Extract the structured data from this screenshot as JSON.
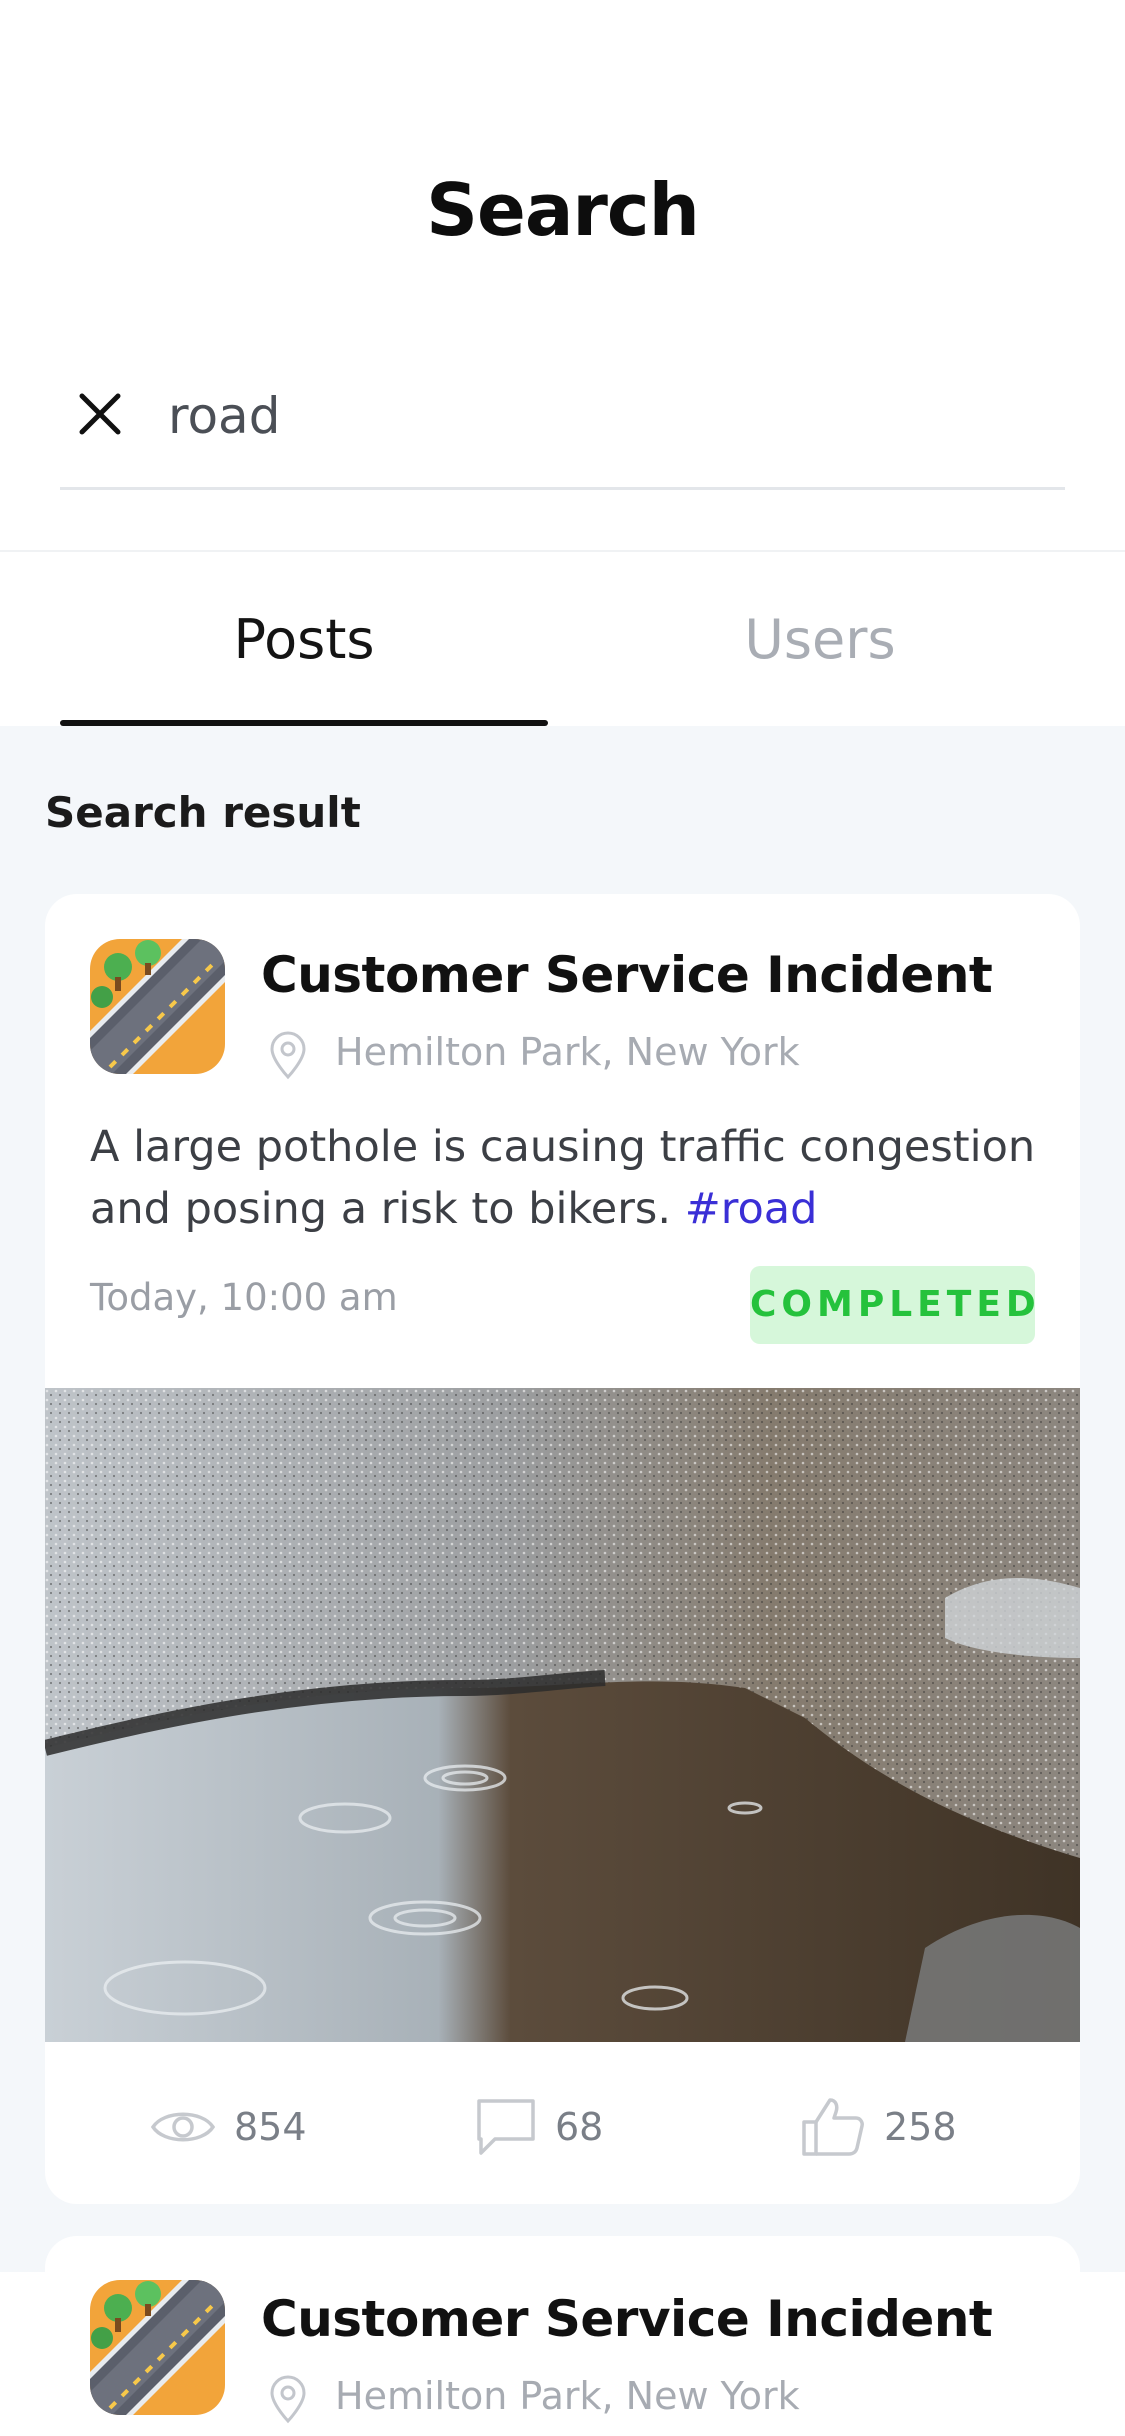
{
  "page": {
    "title": "Search"
  },
  "search": {
    "value": "road",
    "placeholder": "Search"
  },
  "tabs": [
    {
      "label": "Posts",
      "active": true
    },
    {
      "label": "Users",
      "active": false
    }
  ],
  "results": {
    "heading": "Search result",
    "posts": [
      {
        "title": "Customer Service Incident",
        "location": "Hemilton Park, New York",
        "description": "A large pothole is causing traffic congestion and posing a risk to bikers. ",
        "hashtag": "#road",
        "time": "Today, 10:00 am",
        "status": "COMPLETED",
        "views": "854",
        "comments": "68",
        "likes": "258"
      },
      {
        "title": "Customer Service Incident",
        "location": "Hemilton Park, New York"
      }
    ]
  },
  "colors": {
    "accent_hashtag": "#3a2fd6",
    "status_completed_bg": "#d6f7da",
    "status_completed_text": "#25c23c",
    "background": "#F4F7FA"
  },
  "icons": {
    "clear": "close-icon",
    "location": "location-pin-icon",
    "views": "eye-icon",
    "comments": "comment-icon",
    "likes": "thumbs-up-icon"
  }
}
